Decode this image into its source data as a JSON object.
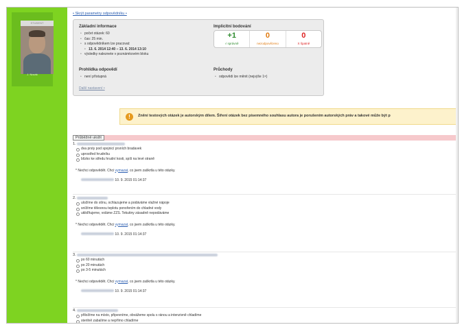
{
  "sidebar": {
    "photo_tag": "STUDENT",
    "name": "J. Novák"
  },
  "header": {
    "toggle_link": "• Skrýt parametry odpovědníku •"
  },
  "panel": {
    "basic_title": "Základní informace",
    "basic_items": [
      "počet otázek: 60",
      "čas: 25 min.",
      "s odpovědníkem lze pracovat:",
      "13. 6. 2014 12:40 – 13. 6. 2014 13:10",
      "výsledky naleznete v poznámkovém bloku"
    ],
    "scoring_title": "Implicitní bodování",
    "scores": [
      {
        "num": "+1",
        "label": "√ správně"
      },
      {
        "num": "0",
        "label": "nezodpovězeno"
      },
      {
        "num": "0",
        "label": "X špatně"
      }
    ],
    "review_title": "Prohlídka odpovědí",
    "review_items": [
      "není přístupná"
    ],
    "pass_title": "Průchody",
    "pass_items": [
      "odpovědi lze měnit (nejvýše 1×)"
    ],
    "more_link": "Další nastavení •"
  },
  "notice": {
    "icon": "!",
    "text": "Znění testových otázek je autorským dílem. Šíření otázek bez písemného souhlasu autora je porušením autorských práv a takové může být p"
  },
  "progress_button": "Průběžně uložit",
  "answer_common": {
    "prefix": "* Nechci odpovědět. Chci",
    "link": "vymazat",
    "suffix": ", co jsem zaškrtla u této otázky."
  },
  "questions": [
    {
      "number": "1.",
      "options": [
        "dva prsty pod spojnicí prsních bradavek",
        "uprostřed hrudníku",
        "blízko ke středu hrudní kosti, spíš na levé straně"
      ],
      "timestamp": "10. 9. 2015 01:14:37"
    },
    {
      "number": "2.",
      "options": [
        "uložíme do stínu, ochlazujeme a podáváme vlažné nápoje",
        "snížíme tělesnou teplotu ponořením do chladné vody",
        "ukliďňujeme, voláme ZZS. Tekutiny zásadně nepodáváme"
      ],
      "timestamp": "10. 9. 2015 01:14:37"
    },
    {
      "number": "3.",
      "options": [
        "po 60 minutách",
        "po 20 minutách",
        "po 3-5 minutách"
      ],
      "timestamp": "10. 9. 2015 01:14:37"
    },
    {
      "number": "4.",
      "options": [
        "přiložíme na místo, připevníme, obvážeme spolu s ránou a intenzivně chladíme",
        "sterilně zabalíme a nepřímo chladíme"
      ],
      "timestamp": ""
    }
  ]
}
